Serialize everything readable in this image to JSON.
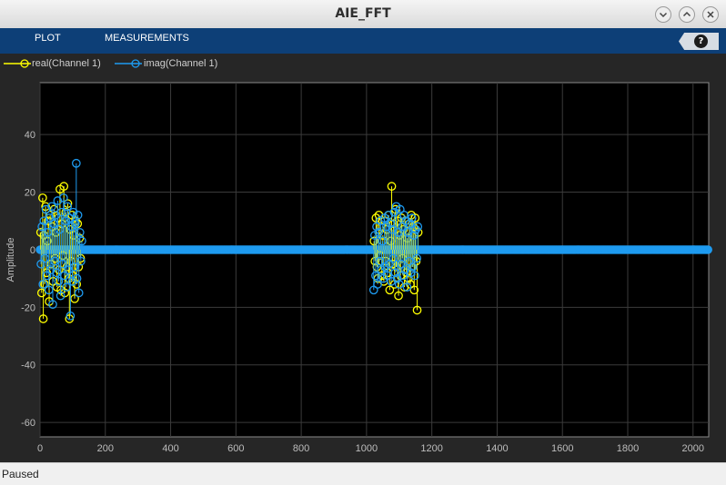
{
  "window": {
    "title": "AIE_FFT",
    "buttons": [
      "minimize",
      "maximize",
      "close"
    ]
  },
  "toolstrip": {
    "tabs": [
      "PLOT",
      "MEASUREMENTS"
    ],
    "help_label": "?"
  },
  "legend": [
    {
      "label": "real(Channel 1)",
      "color": "#ffff00",
      "icon": "line-circle-marker-icon"
    },
    {
      "label": "imag(Channel 1)",
      "color": "#1e9bf0",
      "icon": "line-circle-marker-icon"
    }
  ],
  "status": {
    "text": "Paused"
  },
  "colors": {
    "background": "#262626",
    "axes": "#000000",
    "grid": "#3b3b3b",
    "real": "#ffff00",
    "imag": "#1e9bf0"
  },
  "chart_data": {
    "type": "scatter",
    "style": "stem plot with circle markers",
    "title": "",
    "xlabel": "",
    "ylabel": "Amplitude",
    "xlim": [
      0,
      2048
    ],
    "ylim": [
      -65,
      58
    ],
    "x_ticks": [
      0,
      200,
      400,
      600,
      800,
      1000,
      1200,
      1400,
      1600,
      1800,
      2000
    ],
    "y_ticks": [
      -60,
      -40,
      -20,
      0,
      20,
      40
    ],
    "grid": true,
    "legend_position": "top-left",
    "series": [
      {
        "name": "real(Channel 1)",
        "color": "#ffff00",
        "values_note": "nonzero only in bins ~0-130 and ~1020-1160; zero elsewhere",
        "points": [
          [
            2,
            6
          ],
          [
            5,
            -15
          ],
          [
            8,
            18
          ],
          [
            10,
            -24
          ],
          [
            12,
            5
          ],
          [
            14,
            -12
          ],
          [
            17,
            15
          ],
          [
            20,
            -8
          ],
          [
            22,
            3
          ],
          [
            25,
            10
          ],
          [
            28,
            -18
          ],
          [
            31,
            12
          ],
          [
            34,
            -5
          ],
          [
            37,
            8
          ],
          [
            40,
            -11
          ],
          [
            43,
            14
          ],
          [
            46,
            -3
          ],
          [
            49,
            6
          ],
          [
            52,
            -13
          ],
          [
            55,
            11
          ],
          [
            58,
            -7
          ],
          [
            61,
            21
          ],
          [
            64,
            -14
          ],
          [
            67,
            9
          ],
          [
            70,
            -2
          ],
          [
            73,
            22
          ],
          [
            76,
            -15
          ],
          [
            79,
            13
          ],
          [
            82,
            -6
          ],
          [
            85,
            16
          ],
          [
            88,
            -10
          ],
          [
            90,
            -24
          ],
          [
            92,
            7
          ],
          [
            95,
            -4
          ],
          [
            98,
            12
          ],
          [
            100,
            -9
          ],
          [
            103,
            5
          ],
          [
            106,
            -17
          ],
          [
            109,
            10
          ],
          [
            112,
            -12
          ],
          [
            115,
            9
          ],
          [
            118,
            -6
          ],
          [
            121,
            4
          ],
          [
            124,
            -3
          ],
          [
            1023,
            3
          ],
          [
            1026,
            -4
          ],
          [
            1029,
            11
          ],
          [
            1032,
            -6
          ],
          [
            1035,
            -10
          ],
          [
            1038,
            12
          ],
          [
            1041,
            -2
          ],
          [
            1044,
            8
          ],
          [
            1047,
            -9
          ],
          [
            1050,
            5
          ],
          [
            1053,
            -11
          ],
          [
            1056,
            10
          ],
          [
            1059,
            -4
          ],
          [
            1062,
            7
          ],
          [
            1065,
            -8
          ],
          [
            1068,
            12
          ],
          [
            1071,
            -14
          ],
          [
            1074,
            3
          ],
          [
            1077,
            22
          ],
          [
            1080,
            -5
          ],
          [
            1083,
            9
          ],
          [
            1086,
            -12
          ],
          [
            1089,
            14
          ],
          [
            1092,
            -6
          ],
          [
            1095,
            10
          ],
          [
            1098,
            -16
          ],
          [
            1101,
            5
          ],
          [
            1104,
            -9
          ],
          [
            1107,
            11
          ],
          [
            1110,
            -3
          ],
          [
            1113,
            7
          ],
          [
            1116,
            -13
          ],
          [
            1119,
            10
          ],
          [
            1122,
            -8
          ],
          [
            1125,
            4
          ],
          [
            1128,
            -10
          ],
          [
            1131,
            9
          ],
          [
            1134,
            -12
          ],
          [
            1137,
            12
          ],
          [
            1140,
            -6
          ],
          [
            1143,
            8
          ],
          [
            1146,
            -14
          ],
          [
            1149,
            11
          ],
          [
            1152,
            -4
          ],
          [
            1155,
            -21
          ],
          [
            1158,
            6
          ]
        ]
      },
      {
        "name": "imag(Channel 1)",
        "color": "#1e9bf0",
        "values_note": "nonzero only in bins ~0-130 and ~1020-1160; zero elsewhere",
        "points": [
          [
            3,
            -5
          ],
          [
            6,
            8
          ],
          [
            9,
            -12
          ],
          [
            12,
            10
          ],
          [
            15,
            -3
          ],
          [
            18,
            14
          ],
          [
            21,
            -9
          ],
          [
            24,
            6
          ],
          [
            27,
            -14
          ],
          [
            30,
            11
          ],
          [
            33,
            -7
          ],
          [
            36,
            15
          ],
          [
            39,
            -19
          ],
          [
            42,
            9
          ],
          [
            45,
            -4
          ],
          [
            48,
            12
          ],
          [
            51,
            -8
          ],
          [
            54,
            17
          ],
          [
            57,
            -11
          ],
          [
            60,
            7
          ],
          [
            63,
            -16
          ],
          [
            66,
            13
          ],
          [
            69,
            -5
          ],
          [
            72,
            18
          ],
          [
            75,
            -9
          ],
          [
            78,
            10
          ],
          [
            81,
            -13
          ],
          [
            84,
            15
          ],
          [
            87,
            -7
          ],
          [
            90,
            11
          ],
          [
            93,
            -23
          ],
          [
            96,
            8
          ],
          [
            99,
            -11
          ],
          [
            102,
            13
          ],
          [
            105,
            -6
          ],
          [
            108,
            9
          ],
          [
            111,
            30
          ],
          [
            113,
            -10
          ],
          [
            116,
            12
          ],
          [
            119,
            -15
          ],
          [
            122,
            6
          ],
          [
            125,
            -4
          ],
          [
            128,
            3
          ],
          [
            1022,
            -14
          ],
          [
            1025,
            5
          ],
          [
            1028,
            -9
          ],
          [
            1031,
            8
          ],
          [
            1034,
            -12
          ],
          [
            1037,
            6
          ],
          [
            1040,
            -4
          ],
          [
            1043,
            10
          ],
          [
            1046,
            -7
          ],
          [
            1049,
            3
          ],
          [
            1052,
            -10
          ],
          [
            1055,
            11
          ],
          [
            1058,
            -6
          ],
          [
            1061,
            8
          ],
          [
            1064,
            -9
          ],
          [
            1067,
            12
          ],
          [
            1070,
            -5
          ],
          [
            1073,
            9
          ],
          [
            1076,
            -11
          ],
          [
            1079,
            7
          ],
          [
            1082,
            -3
          ],
          [
            1085,
            13
          ],
          [
            1088,
            -8
          ],
          [
            1091,
            15
          ],
          [
            1094,
            -10
          ],
          [
            1097,
            6
          ],
          [
            1100,
            -12
          ],
          [
            1103,
            14
          ],
          [
            1106,
            -5
          ],
          [
            1109,
            8
          ],
          [
            1112,
            -9
          ],
          [
            1115,
            12
          ],
          [
            1118,
            -7
          ],
          [
            1121,
            10
          ],
          [
            1124,
            -13
          ],
          [
            1127,
            6
          ],
          [
            1130,
            -4
          ],
          [
            1133,
            9
          ],
          [
            1136,
            -8
          ],
          [
            1139,
            11
          ],
          [
            1142,
            -6
          ],
          [
            1145,
            5
          ],
          [
            1148,
            -9
          ],
          [
            1151,
            7
          ],
          [
            1154,
            -3
          ],
          [
            1157,
            8
          ]
        ]
      }
    ]
  }
}
